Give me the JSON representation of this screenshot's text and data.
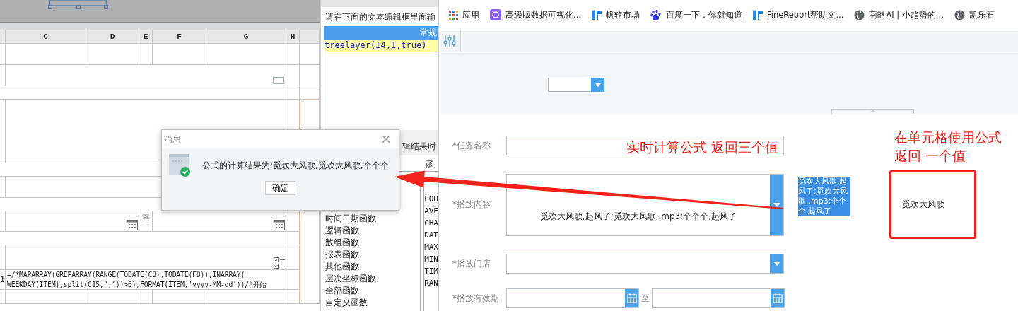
{
  "spreadsheet": {
    "columns": [
      "C",
      "D",
      "E",
      "F",
      "G",
      "H"
    ],
    "date_separator": "至",
    "row_number": "1",
    "formula": "=/*MAPARRAY(GREPARRAY(RANGE(TODATE(C8),TODATE(F8)),INARRAY(\nWEEKDAY(ITEM),split(C15,\",\"))>0),FORMAT(ITEM,'yyyy-MM-dd'))/*开始"
  },
  "function_dialog": {
    "instruction": "请在下面的文本编辑框里面输",
    "tab_label": "常规",
    "code": "treelayer(I4,1,true)",
    "hint": "辑结果时",
    "list_heading": "函",
    "categories": [
      {
        "label": "时间日期函数",
        "selected": false
      },
      {
        "label": "逻辑函数",
        "selected": false
      },
      {
        "label": "数组函数",
        "selected": false
      },
      {
        "label": "报表函数",
        "selected": false
      },
      {
        "label": "其他函数",
        "selected": false
      },
      {
        "label": "层次坐标函数",
        "selected": false
      },
      {
        "label": "全部函数",
        "selected": false
      },
      {
        "label": "自定义函数",
        "selected": false
      }
    ],
    "functions": [
      {
        "label": "COU",
        "selected": false
      },
      {
        "label": "AVE",
        "selected": false
      },
      {
        "label": "CHA",
        "selected": false
      },
      {
        "label": "DAT",
        "selected": false
      },
      {
        "label": "MAX",
        "selected": false
      },
      {
        "label": "MIN",
        "selected": false
      },
      {
        "label": "TIM",
        "selected": false
      },
      {
        "label": "RAN",
        "selected": false
      }
    ]
  },
  "message_dialog": {
    "title": "消息",
    "message": "公式的计算结果为:觅欢大风歌,觅欢大风歌,个个个",
    "button": "确定"
  },
  "bookmarks": [
    {
      "label": "应用",
      "kind": "apps"
    },
    {
      "label": "高级版数据可视化...",
      "kind": "app"
    },
    {
      "label": "帆软市场",
      "kind": "fine"
    },
    {
      "label": "百度一下，你就知道",
      "kind": "baidu"
    },
    {
      "label": "FineReport帮助文...",
      "kind": "fine"
    },
    {
      "label": "商略AI | 小趋势的...",
      "kind": "globe"
    },
    {
      "label": "凯乐石",
      "kind": "globe"
    }
  ],
  "form": {
    "fields": [
      {
        "label": "*任务名称",
        "kind": "text"
      },
      {
        "label": "*播放内容",
        "kind": "textarea",
        "value": "觅欢大风歌,起风了;觅欢大风歌,.mp3;个个个,起风了"
      },
      {
        "label": "*播放门店",
        "kind": "select"
      },
      {
        "label": "*播放有效期",
        "kind": "daterange",
        "separator": "至"
      }
    ],
    "selected_text": "觅欢大风歌,起风了;觅欢大风歌,.mp3;个个个,起风了",
    "cell_value": "觅欢大风歌"
  },
  "annotations": [
    {
      "lines": [
        "实时计算公式 返回三个值"
      ],
      "kind": "inline"
    },
    {
      "lines": [
        "在单元格使用公式",
        "返回 一个值"
      ],
      "kind": "block"
    }
  ]
}
